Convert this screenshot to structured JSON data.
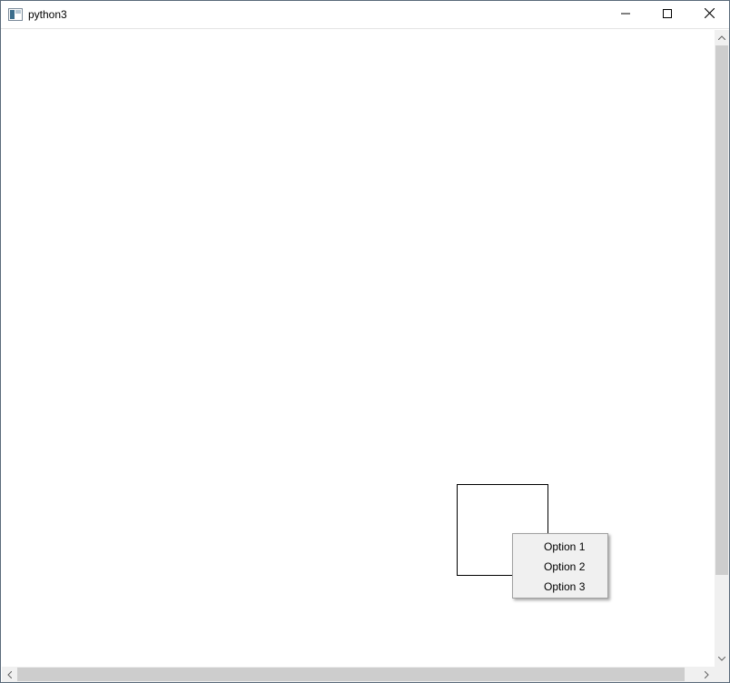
{
  "window": {
    "title": "python3",
    "controls": {
      "minimize_icon": "minimize-icon",
      "maximize_icon": "maximize-icon",
      "close_icon": "close-icon"
    }
  },
  "context_menu": {
    "items": [
      {
        "label": "Option 1"
      },
      {
        "label": "Option 2"
      },
      {
        "label": "Option 3"
      }
    ]
  },
  "colors": {
    "menu_background": "#f0f0f0",
    "scrollbar_thumb": "#cdcdcd",
    "shape_stroke": "#000000"
  }
}
